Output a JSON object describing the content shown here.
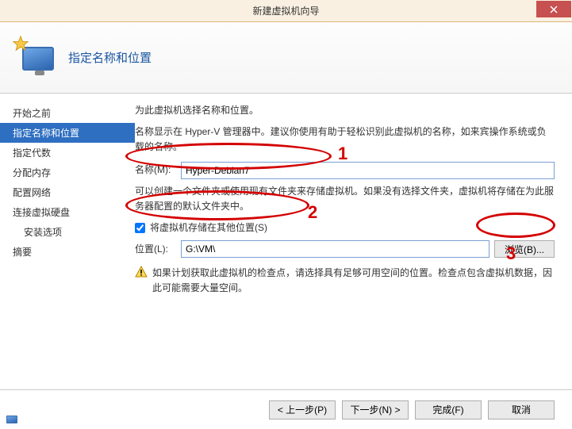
{
  "window": {
    "title": "新建虚拟机向导"
  },
  "header": {
    "title": "指定名称和位置"
  },
  "sidebar": {
    "items": [
      {
        "label": "开始之前"
      },
      {
        "label": "指定名称和位置"
      },
      {
        "label": "指定代数"
      },
      {
        "label": "分配内存"
      },
      {
        "label": "配置网络"
      },
      {
        "label": "连接虚拟硬盘"
      },
      {
        "label": "安装选项"
      },
      {
        "label": "摘要"
      }
    ]
  },
  "content": {
    "intro": "为此虚拟机选择名称和位置。",
    "name_desc": "名称显示在 Hyper-V 管理器中。建议你使用有助于轻松识别此虚拟机的名称，如来宾操作系统或负载的名称。",
    "name_label": "名称(M):",
    "name_value": "Hyper-Debian7",
    "loc_desc": "可以创建一个文件夹或使用现有文件夹来存储虚拟机。如果没有选择文件夹，虚拟机将存储在为此服务器配置的默认文件夹中。",
    "store_checkbox_label": "将虚拟机存储在其他位置(S)",
    "location_label": "位置(L):",
    "location_value": "G:\\VM\\",
    "browse_label": "浏览(B)...",
    "warning": "如果计划获取此虚拟机的检查点，请选择具有足够可用空间的位置。检查点包含虚拟机数据，因此可能需要大量空间。"
  },
  "footer": {
    "prev": "< 上一步(P)",
    "next": "下一步(N) >",
    "finish": "完成(F)",
    "cancel": "取消"
  },
  "annotations": {
    "n1": "1",
    "n2": "2",
    "n3": "3"
  }
}
